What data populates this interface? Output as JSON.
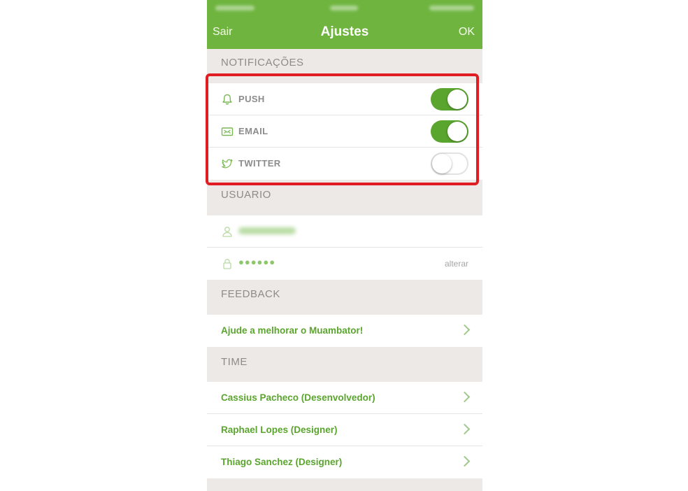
{
  "nav": {
    "left_label": "Sair",
    "title": "Ajustes",
    "right_label": "OK"
  },
  "colors": {
    "brand_green": "#6fb43f",
    "toggle_on": "#5aa52d",
    "link_green": "#5aa52d",
    "highlight_red": "#e11d24"
  },
  "notificacoes": {
    "header": "NOTIFICAÇÕES",
    "items": [
      {
        "label": "PUSH",
        "icon": "bell-icon",
        "enabled": true
      },
      {
        "label": "EMAIL",
        "icon": "mail-icon",
        "enabled": true
      },
      {
        "label": "TWITTER",
        "icon": "twitter-bird-icon",
        "enabled": false
      }
    ]
  },
  "usuario": {
    "header": "USUARIO",
    "password_mask": "●●●●●●",
    "change_label": "alterar"
  },
  "feedback": {
    "header": "FEEDBACK",
    "link": "Ajude a melhorar o Muambator!"
  },
  "time": {
    "header": "TIME",
    "members": [
      "Cassius Pacheco (Desenvolvedor)",
      "Raphael Lopes (Designer)",
      "Thiago Sanchez (Designer)"
    ]
  }
}
